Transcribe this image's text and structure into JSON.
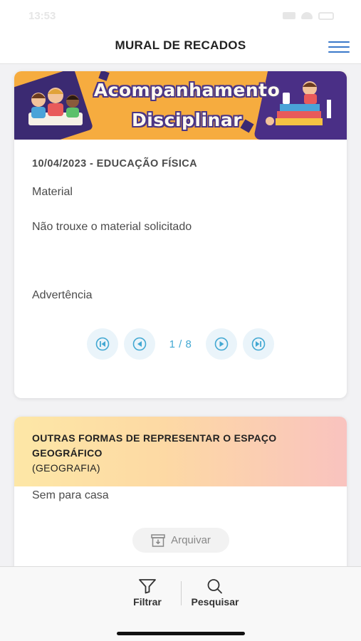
{
  "status_bar": {
    "time": "13:53"
  },
  "header": {
    "title": "MURAL DE RECADOS",
    "menu_icon": "hamburger-menu-icon"
  },
  "card1": {
    "banner": {
      "line1": "Acompanhamento",
      "line2": "Disciplinar"
    },
    "date_subject": "10/04/2023 - EDUCAÇÃO FÍSICA",
    "category": "Material",
    "description": "Não trouxe o material solicitado",
    "type": "Advertência",
    "pager": {
      "label": "1 / 8",
      "accent": "#42a8d2"
    }
  },
  "card2": {
    "title": "OUTRAS FORMAS DE REPRESENTAR O ESPAÇO GEOGRÁFICO",
    "subject": "(GEOGRAFIA)",
    "content": "Sem para casa",
    "archive_label": "Arquivar"
  },
  "bottom_bar": {
    "filter_label": "Filtrar",
    "search_label": "Pesquisar"
  }
}
